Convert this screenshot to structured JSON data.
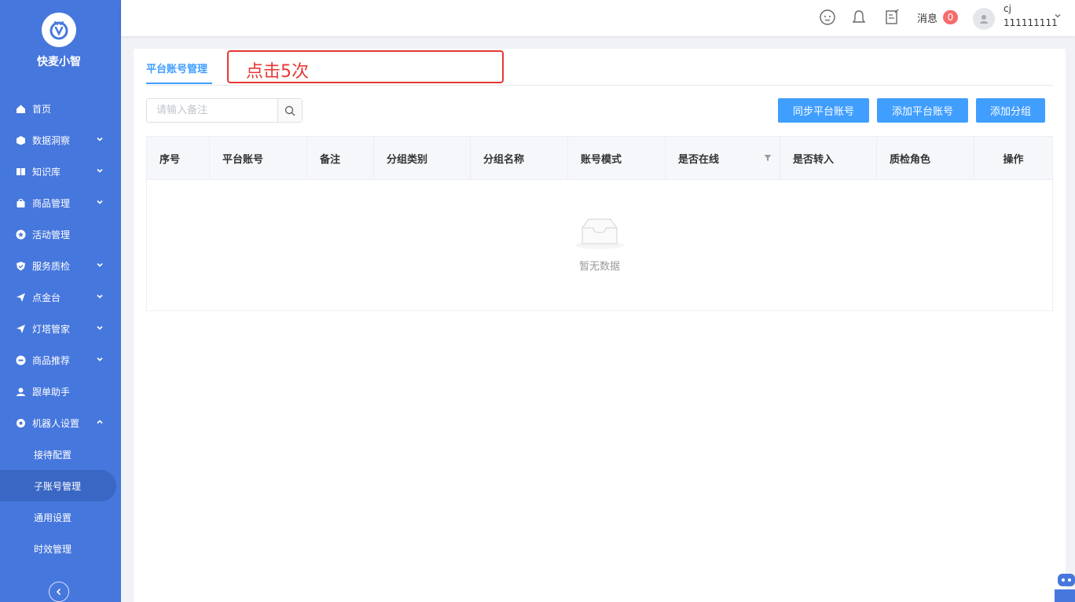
{
  "brand": {
    "name": "快麦小智"
  },
  "sidebar": {
    "items": [
      {
        "label": "首页",
        "icon": "home-icon",
        "expandable": false
      },
      {
        "label": "数据洞察",
        "icon": "cube-icon",
        "expandable": true
      },
      {
        "label": "知识库",
        "icon": "book-icon",
        "expandable": true
      },
      {
        "label": "商品管理",
        "icon": "bag-icon",
        "expandable": true
      },
      {
        "label": "活动管理",
        "icon": "star-icon",
        "expandable": false
      },
      {
        "label": "服务质检",
        "icon": "shield-icon",
        "expandable": true
      },
      {
        "label": "点金台",
        "icon": "send-icon",
        "expandable": true
      },
      {
        "label": "灯塔管家",
        "icon": "send-icon",
        "expandable": true
      },
      {
        "label": "商品推荐",
        "icon": "disc-icon",
        "expandable": true
      },
      {
        "label": "跟单助手",
        "icon": "user-icon",
        "expandable": false
      },
      {
        "label": "机器人设置",
        "icon": "gear-icon",
        "expandable": true,
        "expanded": true
      }
    ],
    "sub_items": [
      {
        "label": "接待配置"
      },
      {
        "label": "子账号管理",
        "active": true
      },
      {
        "label": "通用设置"
      },
      {
        "label": "时效管理"
      }
    ]
  },
  "header": {
    "messages_label": "消息",
    "messages_count": "0",
    "user_name": "cj",
    "user_id": "111111111"
  },
  "tabs": [
    {
      "label": "平台账号管理",
      "active": true
    }
  ],
  "annotation": {
    "text": "点击5次",
    "color": "#e53935"
  },
  "search": {
    "placeholder": "请输入备注"
  },
  "buttons": {
    "sync": "同步平台账号",
    "add_account": "添加平台账号",
    "add_group": "添加分组"
  },
  "table": {
    "columns": [
      "序号",
      "平台账号",
      "备注",
      "分组类别",
      "分组名称",
      "账号模式",
      "是否在线",
      "是否转入",
      "质检角色",
      "操作"
    ],
    "rows": [],
    "empty_text": "暂无数据"
  },
  "colors": {
    "sidebar": "#4677dd",
    "primary": "#409eff",
    "badge": "#f56c6c"
  }
}
